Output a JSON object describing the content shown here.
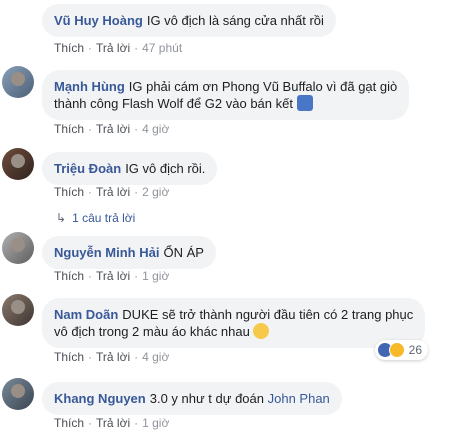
{
  "comments": [
    {
      "author": "Vũ Huy Hoàng",
      "text": "IG vô địch là sáng cửa nhất rồi",
      "like": "Thích",
      "reply": "Trả lời",
      "time": "47 phút"
    },
    {
      "author": "Mạnh Hùng",
      "line1": "IG phải cám ơn Phong Vũ Buffalo vì đã gạt giò",
      "line2": "thành công Flash Wolf để G2 vào bán kết",
      "emoji": "like-emoji",
      "like": "Thích",
      "reply": "Trả lời",
      "time": "4 giờ"
    },
    {
      "author": "Triệu Đoàn",
      "text": "IG vô địch rồi.",
      "like": "Thích",
      "reply": "Trả lời",
      "time": "2 giờ",
      "replies": "1 câu trả lời"
    },
    {
      "author": "Nguyễn Minh Hải",
      "text": "ỔN ÁP",
      "like": "Thích",
      "reply": "Trả lời",
      "time": "1 giờ"
    },
    {
      "author": "Nam Doãn",
      "line1": "DUKE sẽ trở thành người đầu tiên có 2 trang phục",
      "line2": "vô địch trong 2 màu áo khác nhau",
      "emoji": "laugh-emoji",
      "like": "Thích",
      "reply": "Trả lời",
      "time": "4 giờ",
      "reaction_count": "26"
    },
    {
      "author": "Khang Nguyen",
      "text": "3.0 y như t dự đoán",
      "mention": "John Phan",
      "like": "Thích",
      "reply": "Trả lời",
      "time": "1 giờ"
    }
  ],
  "colors": {
    "link": "#385898",
    "bubble": "#f2f3f5",
    "meta": "#90949c"
  }
}
